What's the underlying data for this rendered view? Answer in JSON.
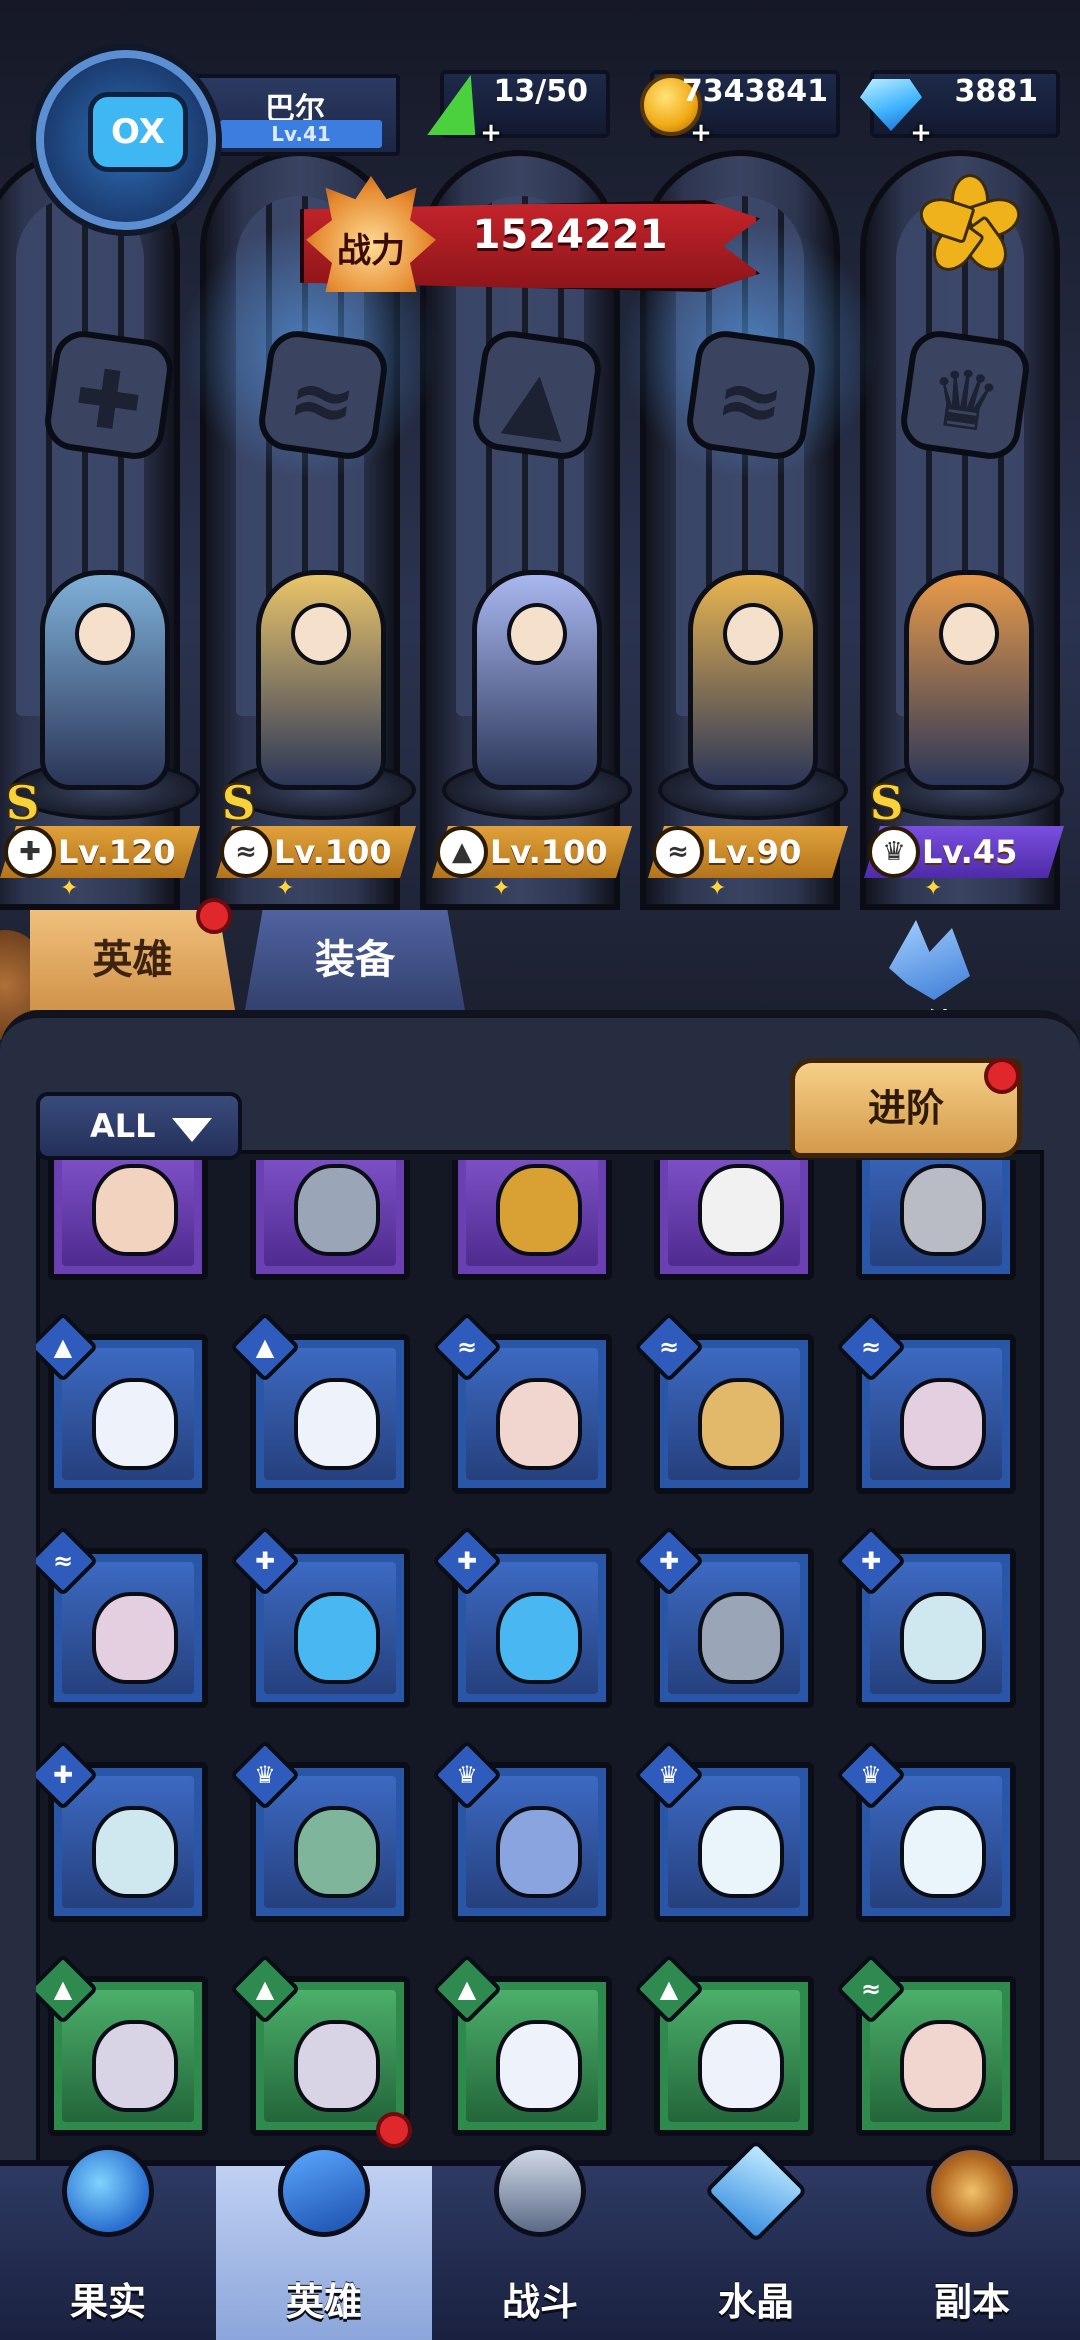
{
  "player": {
    "name": "巴尔",
    "level": "Lv.41"
  },
  "resources": {
    "energy": "13/50",
    "gold": "7343841",
    "gems": "3881"
  },
  "power": {
    "label": "战力",
    "value": "1524221"
  },
  "lineup": [
    {
      "rank": "S",
      "level": "Lv.120",
      "class_icon": "wrench-icon",
      "color": "#7fb0d8"
    },
    {
      "rank": "S",
      "level": "Lv.100",
      "class_icon": "wing-icon",
      "color": "#e9c46a"
    },
    {
      "rank": "",
      "level": "Lv.100",
      "class_icon": "mage-hat-icon",
      "color": "#a9b7f0"
    },
    {
      "rank": "",
      "level": "Lv.90",
      "class_icon": "wing-icon",
      "color": "#e8b450"
    },
    {
      "rank": "S",
      "level": "Lv.45",
      "class_icon": "beast-icon",
      "color": "#e89a4a",
      "tag_color": "purple"
    }
  ],
  "tabs": {
    "heroes": "英雄",
    "equipment": "装备"
  },
  "bond": {
    "label": "羁绊"
  },
  "filter": {
    "label": "ALL"
  },
  "advance": {
    "label": "进阶"
  },
  "grid": [
    [
      {
        "frame": "purple",
        "portrait": "goddess-portrait",
        "class": "",
        "skin": "#f2d3bf"
      },
      {
        "frame": "purple",
        "portrait": "robot-portrait",
        "class": "",
        "skin": "#9aa6b8"
      },
      {
        "frame": "purple",
        "portrait": "mech-portrait",
        "class": "",
        "skin": "#d9a133"
      },
      {
        "frame": "purple",
        "portrait": "panda-portrait",
        "class": "",
        "skin": "#f1f1f1"
      },
      {
        "frame": "blue",
        "portrait": "knight-portrait",
        "class": "",
        "skin": "#b9bcc4"
      }
    ],
    [
      {
        "frame": "blue",
        "portrait": "ice-queen-portrait",
        "class": "mage",
        "skin": "#eef3fb"
      },
      {
        "frame": "blue",
        "portrait": "ice-queen-portrait",
        "class": "mage",
        "skin": "#eef3fb"
      },
      {
        "frame": "blue",
        "portrait": "vampire-portrait",
        "class": "wing",
        "skin": "#f0d6cf"
      },
      {
        "frame": "blue",
        "portrait": "pharaoh-portrait",
        "class": "wing",
        "skin": "#e2b86a"
      },
      {
        "frame": "blue",
        "portrait": "dark-lady-portrait",
        "class": "wing",
        "skin": "#e3cfe0"
      }
    ],
    [
      {
        "frame": "blue",
        "portrait": "dark-lady-portrait",
        "class": "wing",
        "skin": "#e3cfe0"
      },
      {
        "frame": "blue",
        "portrait": "fish-tank-portrait",
        "class": "wrench",
        "skin": "#49b8f2"
      },
      {
        "frame": "blue",
        "portrait": "fish-tank-portrait",
        "class": "wrench",
        "skin": "#49b8f2"
      },
      {
        "frame": "blue",
        "portrait": "robot-portrait",
        "class": "wrench",
        "skin": "#9aa6b8"
      },
      {
        "frame": "blue",
        "portrait": "ghost-portrait",
        "class": "wrench",
        "skin": "#cfe8ef"
      }
    ],
    [
      {
        "frame": "blue",
        "portrait": "ghost-portrait",
        "class": "wrench",
        "skin": "#cfe8ef"
      },
      {
        "frame": "blue",
        "portrait": "elf-queen-portrait",
        "class": "beast",
        "skin": "#7fb59a"
      },
      {
        "frame": "blue",
        "portrait": "dragon-portrait",
        "class": "beast",
        "skin": "#8aa4e0"
      },
      {
        "frame": "blue",
        "portrait": "white-lion-portrait",
        "class": "beast",
        "skin": "#eaf4fb"
      },
      {
        "frame": "blue",
        "portrait": "white-lion-portrait",
        "class": "beast",
        "skin": "#eaf4fb"
      }
    ],
    [
      {
        "frame": "green",
        "portrait": "mummy-portrait",
        "class": "mage",
        "skin": "#d9d3e6"
      },
      {
        "frame": "green",
        "portrait": "mummy-portrait",
        "class": "mage",
        "skin": "#d9d3e6"
      },
      {
        "frame": "green",
        "portrait": "ice-queen-portrait",
        "class": "mage",
        "skin": "#eef3fb"
      },
      {
        "frame": "green",
        "portrait": "ice-queen-portrait",
        "class": "mage",
        "skin": "#eef3fb"
      },
      {
        "frame": "green",
        "portrait": "vampire-portrait",
        "class": "wing",
        "skin": "#f0d6cf"
      }
    ]
  ],
  "class_glyphs": {
    "mage": "▲",
    "wing": "≈",
    "wrench": "✚",
    "beast": "♛"
  },
  "nav": [
    {
      "label": "果实",
      "icon": "fruit-icon",
      "active": false
    },
    {
      "label": "英雄",
      "icon": "hero-hat-icon",
      "active": true
    },
    {
      "label": "战斗",
      "icon": "sword-icon",
      "active": false
    },
    {
      "label": "水晶",
      "icon": "crystal-icon",
      "active": false
    },
    {
      "label": "副本",
      "icon": "portal-icon",
      "active": false
    }
  ],
  "colors": {
    "accent_gold": "#f0b21a",
    "power_red": "#c3242a",
    "tab_active": "#e8b46a",
    "nav_active": "#bfd0f2"
  }
}
